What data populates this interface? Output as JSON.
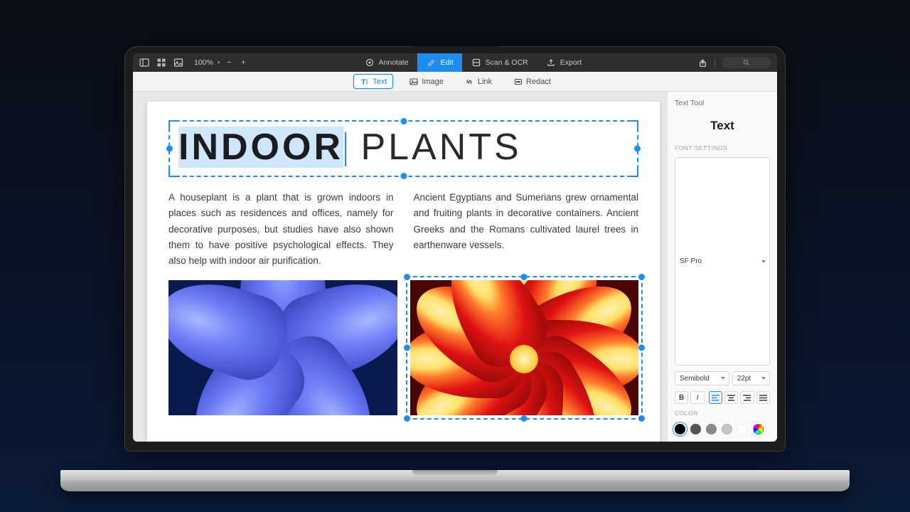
{
  "topbar": {
    "zoom": "100%",
    "tabs": {
      "annotate": "Annotate",
      "edit": "Edit",
      "scan": "Scan & OCR",
      "export": "Export"
    }
  },
  "subbar": {
    "text": "Text",
    "image": "Image",
    "link": "Link",
    "redact": "Redact"
  },
  "doc": {
    "title_sel": "INDOOR",
    "title_rest": " PLANTS",
    "col1": "A houseplant is a plant that is grown indoors in places such as residences and offices, namely for decorative purposes, but studies have also shown them to have positive psychological effects. They also help with indoor air purification.",
    "col2": "Ancient Egyptians and Sumerians grew ornamental and fruiting plants in decorative containers. Ancient Greeks and the Romans cultivated laurel trees in earthenware vessels."
  },
  "panel": {
    "title": "Text Tool",
    "sample": "Text",
    "section_font": "FONT SETTINGS",
    "font_family": "SF Pro",
    "font_weight": "Semibold",
    "font_size": "22pt",
    "section_color": "COLOR",
    "colors": [
      "#000000",
      "#555557",
      "#8a8a8c",
      "#c5c5c7",
      "#ffffff"
    ]
  }
}
